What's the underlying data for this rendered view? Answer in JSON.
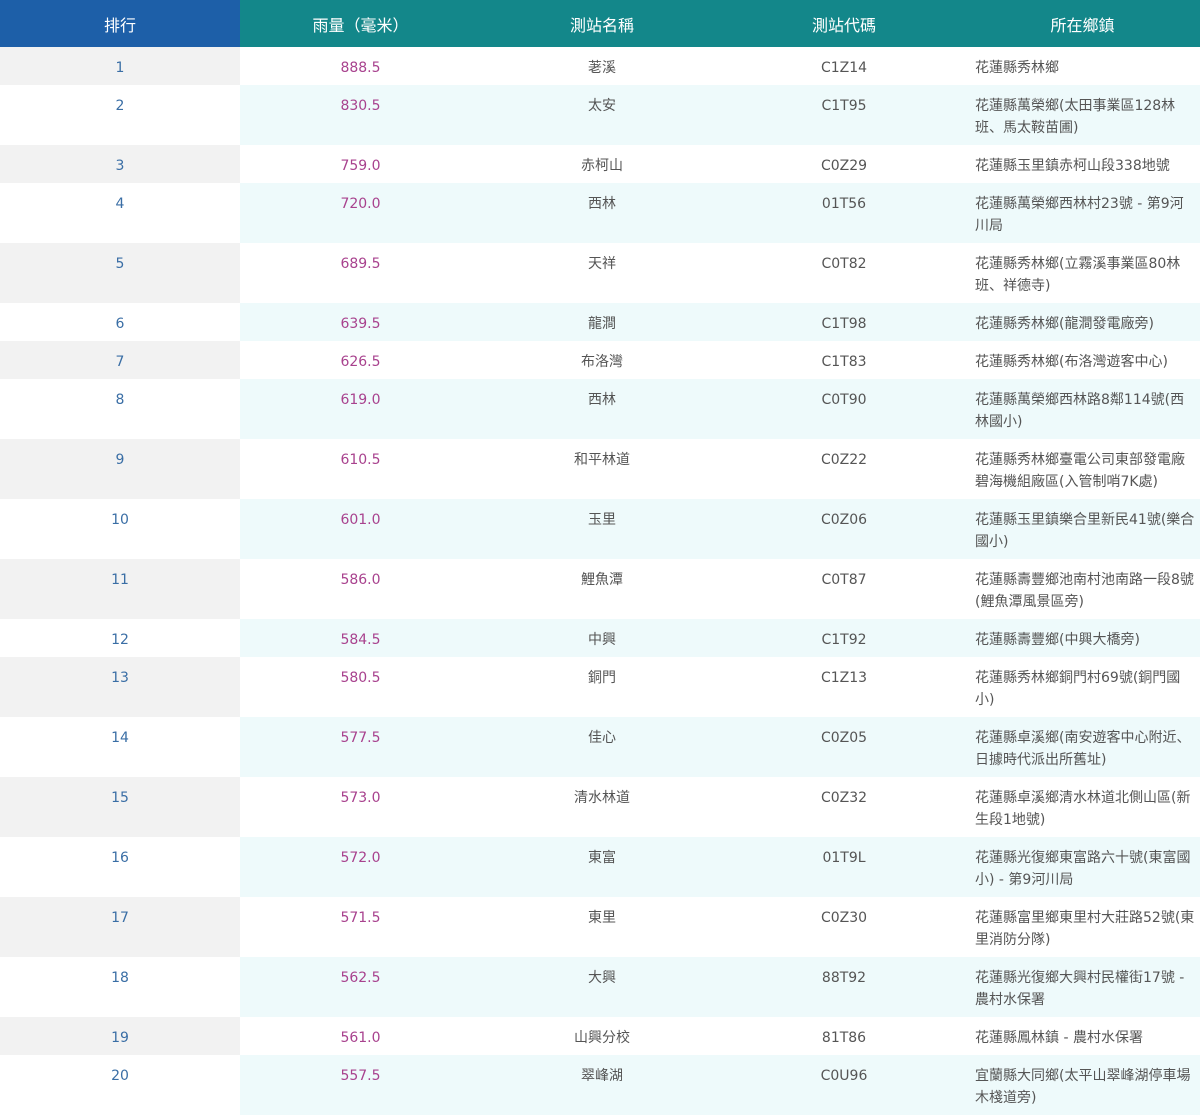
{
  "table": {
    "headers": {
      "rank": "排行",
      "rainfall": "雨量（毫米）",
      "station_name": "測站名稱",
      "station_code": "測站代碼",
      "township": "所在鄉鎮"
    },
    "rows": [
      {
        "rank": "1",
        "rainfall": "888.5",
        "name": "荖溪",
        "code": "C1Z14",
        "town": "花蓮縣秀林鄉"
      },
      {
        "rank": "2",
        "rainfall": "830.5",
        "name": "太安",
        "code": "C1T95",
        "town": "花蓮縣萬榮鄉(太田事業區128林班、馬太鞍苗圃)"
      },
      {
        "rank": "3",
        "rainfall": "759.0",
        "name": "赤柯山",
        "code": "C0Z29",
        "town": "花蓮縣玉里鎮赤柯山段338地號"
      },
      {
        "rank": "4",
        "rainfall": "720.0",
        "name": "西林",
        "code": "01T56",
        "town": "花蓮縣萬榮鄉西林村23號 - 第9河川局"
      },
      {
        "rank": "5",
        "rainfall": "689.5",
        "name": "天祥",
        "code": "C0T82",
        "town": "花蓮縣秀林鄉(立霧溪事業區80林班、祥德寺)"
      },
      {
        "rank": "6",
        "rainfall": "639.5",
        "name": "龍澗",
        "code": "C1T98",
        "town": "花蓮縣秀林鄉(龍澗發電廠旁)"
      },
      {
        "rank": "7",
        "rainfall": "626.5",
        "name": "布洛灣",
        "code": "C1T83",
        "town": "花蓮縣秀林鄉(布洛灣遊客中心)"
      },
      {
        "rank": "8",
        "rainfall": "619.0",
        "name": "西林",
        "code": "C0T90",
        "town": "花蓮縣萬榮鄉西林路8鄰114號(西林國小)"
      },
      {
        "rank": "9",
        "rainfall": "610.5",
        "name": "和平林道",
        "code": "C0Z22",
        "town": "花蓮縣秀林鄉臺電公司東部發電廠碧海機組廠區(入管制哨7K處)"
      },
      {
        "rank": "10",
        "rainfall": "601.0",
        "name": "玉里",
        "code": "C0Z06",
        "town": "花蓮縣玉里鎮樂合里新民41號(樂合國小)"
      },
      {
        "rank": "11",
        "rainfall": "586.0",
        "name": "鯉魚潭",
        "code": "C0T87",
        "town": "花蓮縣壽豐鄉池南村池南路一段8號(鯉魚潭風景區旁)"
      },
      {
        "rank": "12",
        "rainfall": "584.5",
        "name": "中興",
        "code": "C1T92",
        "town": "花蓮縣壽豐鄉(中興大橋旁)"
      },
      {
        "rank": "13",
        "rainfall": "580.5",
        "name": "銅門",
        "code": "C1Z13",
        "town": "花蓮縣秀林鄉銅門村69號(銅門國小)"
      },
      {
        "rank": "14",
        "rainfall": "577.5",
        "name": "佳心",
        "code": "C0Z05",
        "town": "花蓮縣卓溪鄉(南安遊客中心附近、日據時代派出所舊址)"
      },
      {
        "rank": "15",
        "rainfall": "573.0",
        "name": "清水林道",
        "code": "C0Z32",
        "town": "花蓮縣卓溪鄉清水林道北側山區(新生段1地號)"
      },
      {
        "rank": "16",
        "rainfall": "572.0",
        "name": "東富",
        "code": "01T9L",
        "town": "花蓮縣光復鄉東富路六十號(東富國小) - 第9河川局"
      },
      {
        "rank": "17",
        "rainfall": "571.5",
        "name": "東里",
        "code": "C0Z30",
        "town": "花蓮縣富里鄉東里村大莊路52號(東里消防分隊)"
      },
      {
        "rank": "18",
        "rainfall": "562.5",
        "name": "大興",
        "code": "88T92",
        "town": "花蓮縣光復鄉大興村民權街17號 - 農村水保署"
      },
      {
        "rank": "19",
        "rainfall": "561.0",
        "name": "山興分校",
        "code": "81T86",
        "town": "花蓮縣鳳林鎮 - 農村水保署"
      },
      {
        "rank": "20",
        "rainfall": "557.5",
        "name": "翠峰湖",
        "code": "C0U96",
        "town": "宜蘭縣大同鄉(太平山翠峰湖停車場木棧道旁)"
      }
    ]
  }
}
